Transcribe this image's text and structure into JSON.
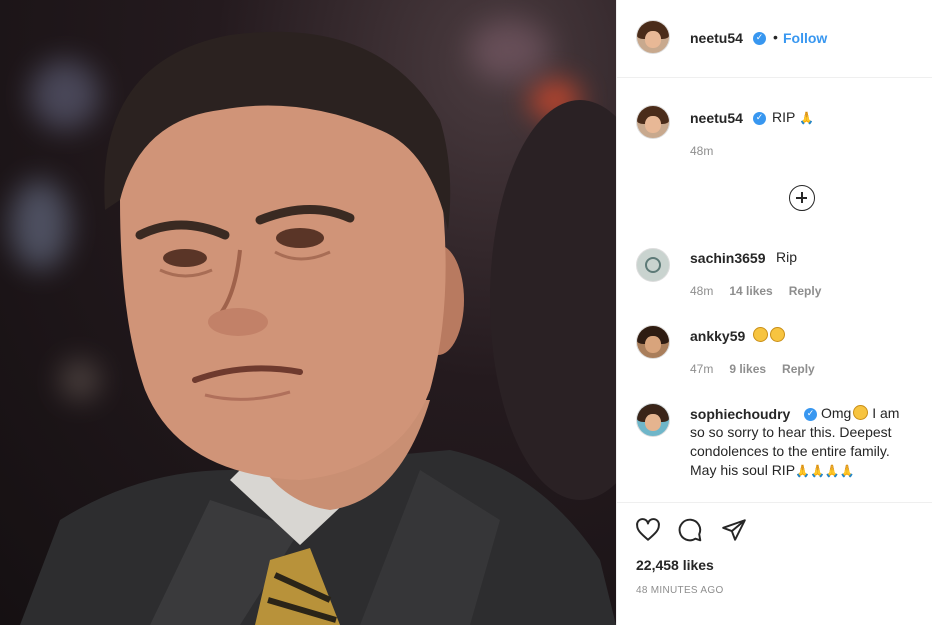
{
  "header": {
    "username": "neetu54",
    "follow_label": "Follow",
    "separator": "•"
  },
  "caption": {
    "username": "neetu54",
    "text": "RIP",
    "time": "48m"
  },
  "comments": [
    {
      "username": "sachin3659",
      "text": "Rip",
      "time": "48m",
      "likes": "14 likes",
      "reply": "Reply"
    },
    {
      "username": "ankky59",
      "text": "",
      "time": "47m",
      "likes": "9 likes",
      "reply": "Reply"
    },
    {
      "username": "sophiechoudry",
      "text_line1": "Omg",
      "text_line1b": " I am",
      "text_line2": "so so sorry to hear this. Deepest",
      "text_line3": "condolences to the entire family.",
      "text_line4": "May his soul RIP"
    }
  ],
  "footer": {
    "likes": "22,458 likes",
    "ago": "48 MINUTES AGO"
  },
  "colors": {
    "link_blue": "#3897f0",
    "muted": "#8e8e8e",
    "text": "#262626",
    "border": "#efefef"
  },
  "icons": [
    "verified-badge-icon",
    "folded-hands-emoji-icon",
    "load-more-plus-icon",
    "sad-face-emoji-icon",
    "heart-icon",
    "comment-icon",
    "share-icon"
  ]
}
